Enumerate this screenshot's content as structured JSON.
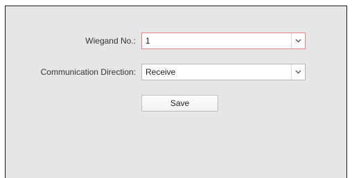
{
  "form": {
    "wiegand": {
      "label": "Wiegand No.:",
      "value": "1",
      "arrow_icon": "chevron-down-icon"
    },
    "direction": {
      "label": "Communication Direction:",
      "value": "Receive",
      "arrow_icon": "chevron-down-icon"
    },
    "save_label": "Save"
  },
  "colors": {
    "panel_background": "#e6e6e6",
    "focus_border": "#e2848a",
    "input_border": "#b4b4b4"
  }
}
